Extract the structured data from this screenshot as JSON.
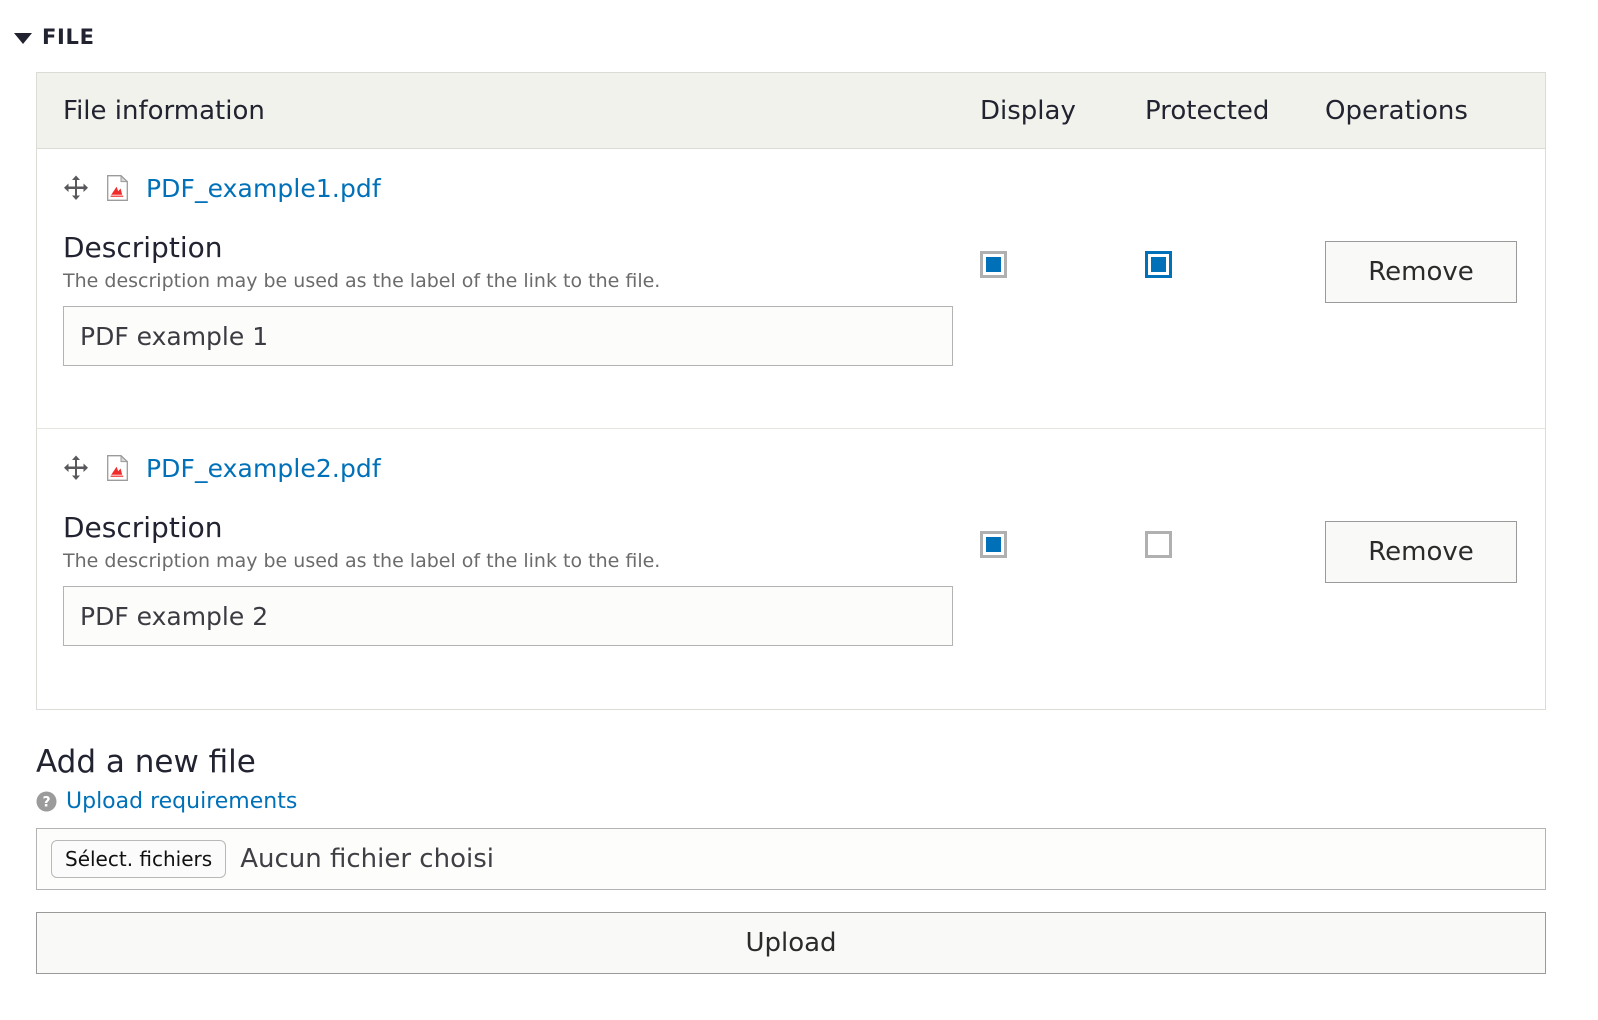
{
  "fieldset": {
    "legend": "FILE",
    "toggle_icon": "triangle-down-icon",
    "expanded": true
  },
  "table": {
    "columns": {
      "file_information": "File information",
      "display": "Display",
      "protected": "Protected",
      "operations": "Operations"
    },
    "rows": [
      {
        "drag_icon": "drag-move-icon",
        "file_icon": "pdf-file-icon",
        "filename": "PDF_example1.pdf",
        "description_label": "Description",
        "description_hint": "The description may be used as the label of the link to the file.",
        "description_value": "PDF example 1",
        "description_placeholder": "",
        "display_checked": true,
        "display_focused": false,
        "protected_checked": true,
        "protected_focused": true,
        "remove_label": "Remove"
      },
      {
        "drag_icon": "drag-move-icon",
        "file_icon": "pdf-file-icon",
        "filename": "PDF_example2.pdf",
        "description_label": "Description",
        "description_hint": "The description may be used as the label of the link to the file.",
        "description_value": "PDF example 2",
        "description_placeholder": "",
        "display_checked": true,
        "display_focused": false,
        "protected_checked": false,
        "protected_focused": false,
        "remove_label": "Remove"
      }
    ]
  },
  "add_file": {
    "title": "Add a new file",
    "help_icon": "question-mark-circle-icon",
    "requirements_link": "Upload requirements",
    "choose_button": "Sélect. fichiers",
    "chosen_file_text": "Aucun fichier choisi",
    "upload_button": "Upload"
  },
  "colors": {
    "link": "#0071b8",
    "accent_checkbox": "#0071b8",
    "header_bg": "#f1f2ec",
    "border": "#dcdcd6",
    "text": "#222330",
    "hint_text": "#6b6b6b",
    "pdf_icon_red": "#e02020"
  }
}
